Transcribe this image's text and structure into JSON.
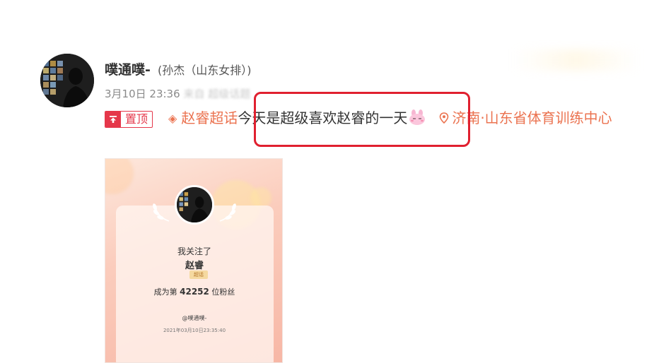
{
  "post": {
    "username": "噗通噗-",
    "realname": "(孙杰（山东女排）)",
    "date": "3月10日 23:36",
    "source": "来自 超级话题",
    "pin": {
      "icon": "pin-top-icon",
      "label": "置顶"
    },
    "topic": {
      "icon": "super-topic-diamond-icon",
      "label": "赵睿超话"
    },
    "text": "今天是超级喜欢赵睿的一天",
    "emoji": "bunny-emoji",
    "location": {
      "icon": "location-pin-icon",
      "label": "济南·山东省体育训练中心"
    },
    "highlight_color": "#e0202f",
    "accent_color": "#eb7350"
  },
  "image_card": {
    "follow_text": "我关注了",
    "name": "赵睿",
    "tag": "超话",
    "rank_prefix": "成为第",
    "rank_number": "42252",
    "rank_suffix": "位粉丝",
    "handle": "@噗通噗-",
    "timestamp": "2021年03月10日23:35:40"
  }
}
